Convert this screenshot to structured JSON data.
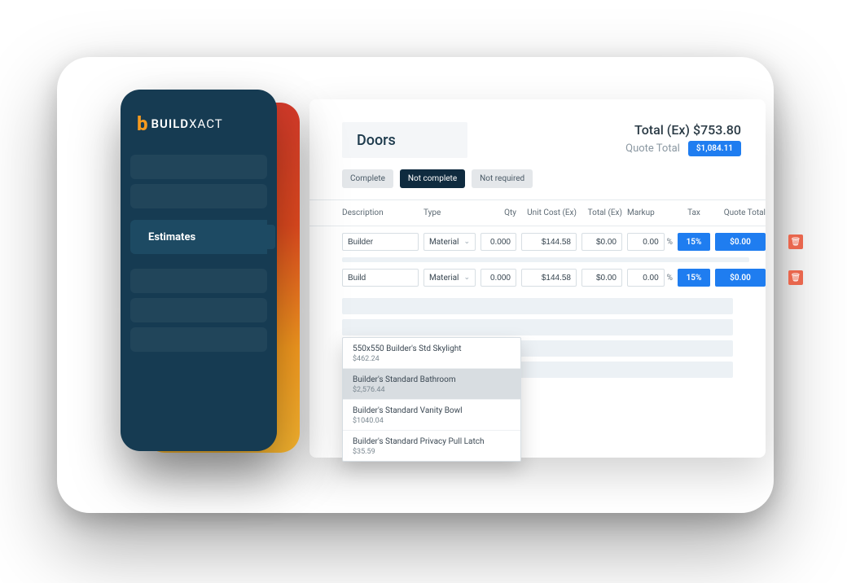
{
  "brand": {
    "mark": "b",
    "name_bold": "BUILD",
    "name_thin": "XACT"
  },
  "sidebar": {
    "active_label": "Estimates"
  },
  "header": {
    "title": "Doors",
    "total_ex_label": "Total (Ex)",
    "total_ex_value": "$753.80",
    "quote_total_label": "Quote Total",
    "quote_total_value": "$1,084.11"
  },
  "status": {
    "complete": "Complete",
    "not_complete": "Not complete",
    "not_required": "Not required",
    "active": "not_complete"
  },
  "columns": {
    "description": "Description",
    "type": "Type",
    "qty": "Qty",
    "unit_cost": "Unit Cost (Ex)",
    "total_ex": "Total (Ex)",
    "markup": "Markup",
    "tax": "Tax",
    "quote_total": "Quote Total"
  },
  "type_options": [
    "Material"
  ],
  "rows": [
    {
      "description": "Builder",
      "type": "Material",
      "qty": "0.000",
      "unit_cost": "$144.58",
      "total_ex": "$0.00",
      "markup": "0.00",
      "markup_unit": "%",
      "tax": "15%",
      "quote_total": "$0.00"
    },
    {
      "description": "Build",
      "type": "Material",
      "qty": "0.000",
      "unit_cost": "$144.58",
      "total_ex": "$0.00",
      "markup": "0.00",
      "markup_unit": "%",
      "tax": "15%",
      "quote_total": "$0.00"
    }
  ],
  "autocomplete": {
    "selected_index": 1,
    "options": [
      {
        "name": "550x550 Builder's Std Skylight",
        "price": "$462.24"
      },
      {
        "name": "Builder's Standard Bathroom",
        "price": "$2,576.44"
      },
      {
        "name": "Builder's Standard Vanity Bowl",
        "price": "$1040.04"
      },
      {
        "name": "Builder's Standard Privacy Pull Latch",
        "price": "$35.59"
      }
    ]
  },
  "icons": {
    "delete": "🗑"
  }
}
